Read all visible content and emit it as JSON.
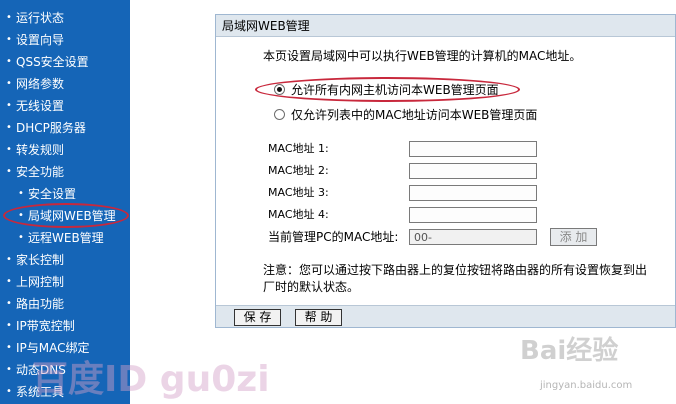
{
  "sidebar": {
    "items": [
      {
        "label": "运行状态",
        "sub": false
      },
      {
        "label": "设置向导",
        "sub": false
      },
      {
        "label": "QSS安全设置",
        "sub": false
      },
      {
        "label": "网络参数",
        "sub": false
      },
      {
        "label": "无线设置",
        "sub": false
      },
      {
        "label": "DHCP服务器",
        "sub": false
      },
      {
        "label": "转发规则",
        "sub": false
      },
      {
        "label": "安全功能",
        "sub": false
      },
      {
        "label": "安全设置",
        "sub": true
      },
      {
        "label": "局域网WEB管理",
        "sub": true
      },
      {
        "label": "远程WEB管理",
        "sub": true
      },
      {
        "label": "家长控制",
        "sub": false
      },
      {
        "label": "上网控制",
        "sub": false
      },
      {
        "label": "路由功能",
        "sub": false
      },
      {
        "label": "IP带宽控制",
        "sub": false
      },
      {
        "label": "IP与MAC绑定",
        "sub": false
      },
      {
        "label": "动态DNS",
        "sub": false
      },
      {
        "label": "系统工具",
        "sub": false
      }
    ],
    "bullet": "•"
  },
  "panel": {
    "title": "局域网WEB管理",
    "description": "本页设置局域网中可以执行WEB管理的计算机的MAC地址。",
    "options": [
      {
        "label": "允许所有内网主机访问本WEB管理页面",
        "checked": true
      },
      {
        "label": "仅允许列表中的MAC地址访问本WEB管理页面",
        "checked": false
      }
    ],
    "mac_fields": [
      {
        "label": "MAC地址 1:",
        "value": ""
      },
      {
        "label": "MAC地址 2:",
        "value": ""
      },
      {
        "label": "MAC地址 3:",
        "value": ""
      },
      {
        "label": "MAC地址 4:",
        "value": ""
      }
    ],
    "current_mac": {
      "label": "当前管理PC的MAC地址:",
      "value": "00-"
    },
    "add_button": "添 加",
    "note": "注意：您可以通过按下路由器上的复位按钮将路由器的所有设置恢复到出厂时的默认状态。",
    "save_button": "保 存",
    "help_button": "帮 助"
  },
  "watermarks": {
    "baidu_id": "百度ID gu0zi",
    "baidu_jingyan": "Bai经验",
    "url": "jingyan.baidu.com"
  },
  "colors": {
    "sidebar_bg": "#1565b7",
    "highlight": "#c8283c",
    "panel_header": "#dfe7ee"
  }
}
